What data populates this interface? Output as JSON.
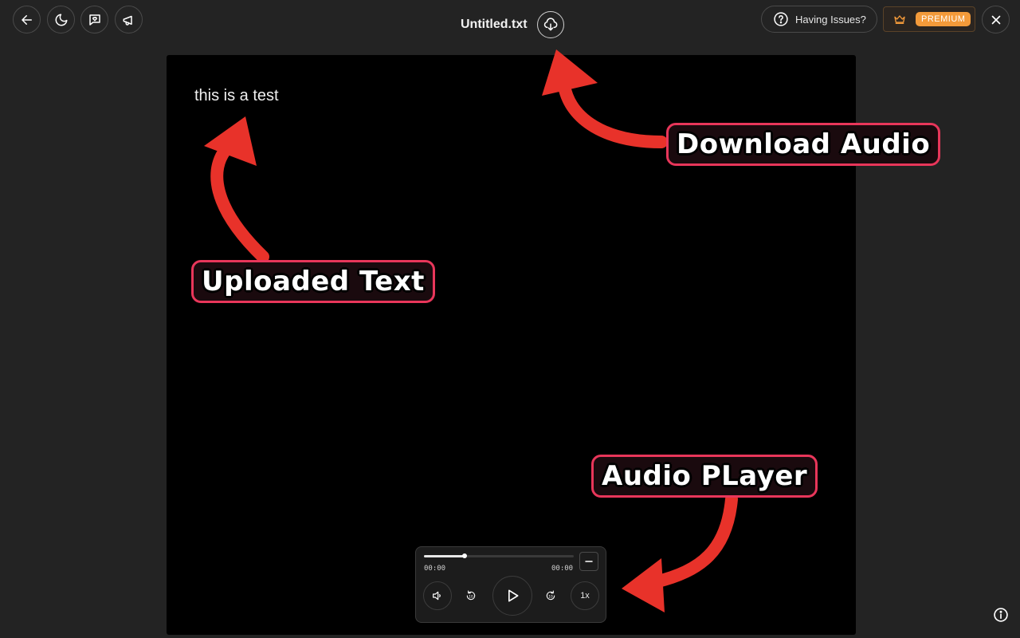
{
  "header": {
    "title": "Untitled.txt",
    "issues_label": "Having Issues?",
    "premium_label": "PREMIUM"
  },
  "document": {
    "text": "this is a test"
  },
  "annotations": {
    "uploaded_text": "Uploaded Text",
    "download_audio": "Download Audio",
    "audio_player": "Audio PLayer"
  },
  "player": {
    "current_time": "00:00",
    "total_time": "00:00",
    "speed_label": "1x",
    "progress_fraction": 0.27
  },
  "colors": {
    "background": "#232323",
    "canvas": "#000000",
    "accent_premium": "#f39a3a",
    "annotation_border": "#e8365a",
    "arrow": "#e8322a"
  },
  "icons": {
    "back": "arrow-left-icon",
    "theme": "moon-icon",
    "feedback": "chat-heart-icon",
    "announce": "megaphone-icon",
    "download": "cloud-download-icon",
    "help": "question-circle-icon",
    "premium": "crown-icon",
    "close": "close-icon",
    "info": "info-icon"
  }
}
